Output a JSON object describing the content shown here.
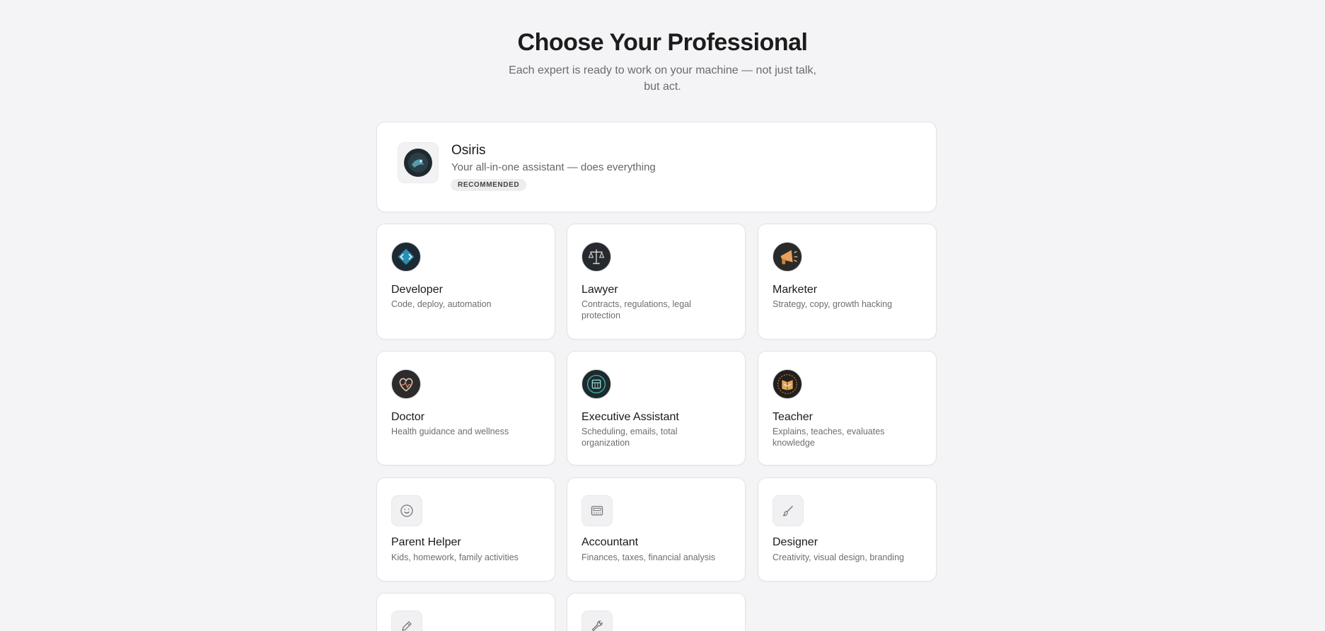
{
  "header": {
    "title": "Choose Your Professional",
    "subtitle": "Each expert is ready to work on your machine — not just talk, but act."
  },
  "featured": {
    "name": "Osiris",
    "description": "Your all-in-one assistant — does everything",
    "badge": "RECOMMENDED",
    "icon": "osiris-avatar-icon"
  },
  "professionals": [
    {
      "name": "Developer",
      "description": "Code, deploy, automation",
      "icon": "developer-avatar-icon"
    },
    {
      "name": "Lawyer",
      "description": "Contracts, regulations, legal protection",
      "icon": "scales-avatar-icon"
    },
    {
      "name": "Marketer",
      "description": "Strategy, copy, growth hacking",
      "icon": "megaphone-avatar-icon"
    },
    {
      "name": "Doctor",
      "description": "Health guidance and wellness",
      "icon": "heart-avatar-icon"
    },
    {
      "name": "Executive Assistant",
      "description": "Scheduling, emails, total organization",
      "icon": "calendar-avatar-icon"
    },
    {
      "name": "Teacher",
      "description": "Explains, teaches, evaluates knowledge",
      "icon": "book-avatar-icon"
    },
    {
      "name": "Parent Helper",
      "description": "Kids, homework, family activities",
      "icon": "smiley-icon"
    },
    {
      "name": "Accountant",
      "description": "Finances, taxes, financial analysis",
      "icon": "calculator-icon"
    },
    {
      "name": "Designer",
      "description": "Creativity, visual design, branding",
      "icon": "paintbrush-icon"
    },
    {
      "name": "",
      "description": "",
      "icon": "pencil-icon"
    },
    {
      "name": "",
      "description": "",
      "icon": "wrench-icon"
    }
  ]
}
